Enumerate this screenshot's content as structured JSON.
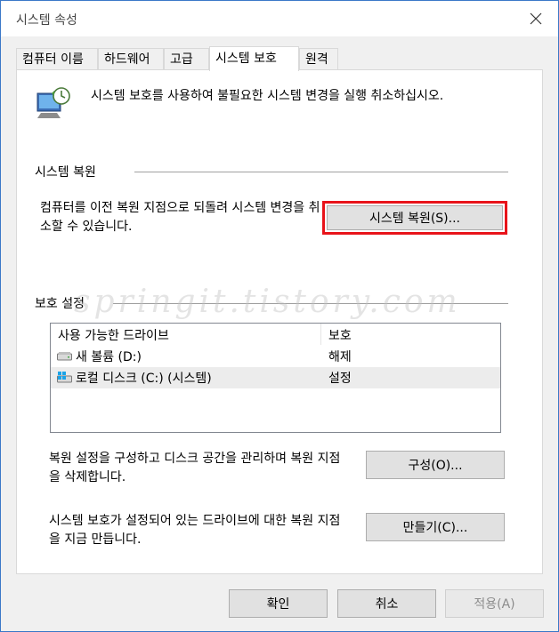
{
  "window": {
    "title": "시스템 속성"
  },
  "tabs": [
    {
      "label": "컴퓨터 이름"
    },
    {
      "label": "하드웨어"
    },
    {
      "label": "고급"
    },
    {
      "label": "시스템 보호"
    },
    {
      "label": "원격"
    }
  ],
  "active_tab": "시스템 보호",
  "intro": {
    "text": "시스템 보호를 사용하여 불필요한 시스템 변경을 실행 취소하십시오.",
    "icon": "system-protection-icon"
  },
  "restore": {
    "section_label": "시스템 복원",
    "description": "컴퓨터를 이전 복원 지점으로 되돌려 시스템 변경을 취소할 수 있습니다.",
    "button_label": "시스템 복원(S)...",
    "highlight_color": "#e8131a"
  },
  "protection": {
    "section_label": "보호 설정",
    "columns": [
      "사용 가능한 드라이브",
      "보호"
    ],
    "drives": [
      {
        "name": "새 볼륨 (D:)",
        "status": "해제",
        "icon": "drive-icon"
      },
      {
        "name": "로컬 디스크 (C:) (시스템)",
        "status": "설정",
        "icon": "system-drive-icon"
      }
    ],
    "configure_text": "복원 설정을 구성하고 디스크 공간을 관리하며 복원 지점을 삭제합니다.",
    "configure_button": "구성(O)...",
    "create_text": "시스템 보호가 설정되어 있는 드라이브에 대한 복원 지점을 지금 만듭니다.",
    "create_button": "만들기(C)..."
  },
  "footer": {
    "ok": "확인",
    "cancel": "취소",
    "apply": "적용(A)"
  },
  "watermark": "springit.tistory.com",
  "colors": {
    "window_border": "#3b78c8",
    "dialog_bg": "#f0f0f0",
    "button_bg": "#e1e1e1",
    "highlight": "#e8131a"
  }
}
